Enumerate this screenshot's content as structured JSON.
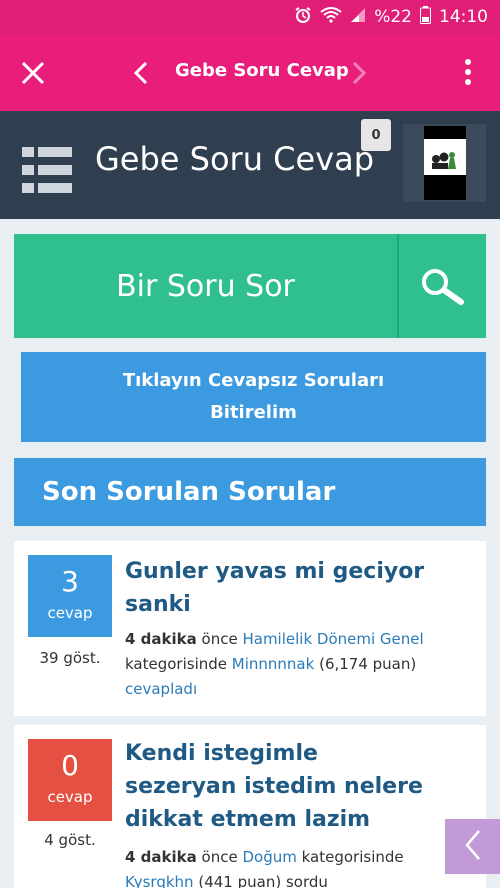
{
  "status_bar": {
    "battery": "%22",
    "time": "14:10"
  },
  "app_bar": {
    "title": "Gebe Soru Cevap"
  },
  "header": {
    "site_title": "Gebe Soru Cevap",
    "notifications": "0"
  },
  "ask": {
    "label": "Bir Soru Sor"
  },
  "banner": {
    "text": "Tıklayın Cevapsız Soruları Bitirelim"
  },
  "section": {
    "title": "Son Sorulan Sorular"
  },
  "questions": [
    {
      "answers": "3",
      "answers_label": "cevap",
      "views": "39 göst.",
      "color": "#3c9ae0",
      "title": "Gunler yavas mi geciyor sanki",
      "time": "4 dakika",
      "time_suffix": "önce",
      "category": "Hamilelik Dönemi Genel",
      "in_text": "kategorisinde",
      "user": "Minnnnnak",
      "points": "(6,174 puan)",
      "action": "cevapladı"
    },
    {
      "answers": "0",
      "answers_label": "cevap",
      "views": "4 göst.",
      "color": "#e45041",
      "title": "Kendi istegimle sezeryan istedim nelere dikkat etmem lazim",
      "time": "4 dakika",
      "time_suffix": "önce",
      "category": "Doğum",
      "in_text": "kategorisinde",
      "user": "Kysrqkhn",
      "points": "(441 puan)",
      "action": "sordu"
    }
  ]
}
